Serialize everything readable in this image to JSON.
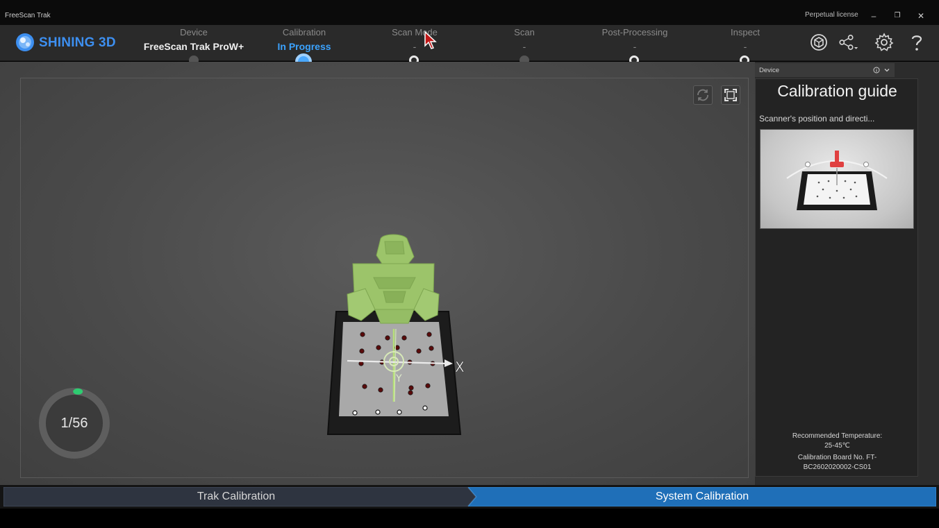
{
  "window": {
    "title": "FreeScan Trak",
    "license": "Perpetual license",
    "minimize": "–",
    "restore": "❐",
    "close": "✕"
  },
  "brand": {
    "name": "SHINING 3D"
  },
  "steps": [
    {
      "label": "Device",
      "value": "FreeScan Trak ProW+"
    },
    {
      "label": "Calibration",
      "value": "In Progress"
    },
    {
      "label": "Scan Mode",
      "value": "-"
    },
    {
      "label": "Scan",
      "value": "-"
    },
    {
      "label": "Post-Processing",
      "value": "-"
    },
    {
      "label": "Inspect",
      "value": "-"
    }
  ],
  "toolbar": {
    "icons": [
      "model-icon",
      "share-icon",
      "settings-gear-icon",
      "help-icon"
    ]
  },
  "viewport": {
    "progress_text": "1/56",
    "progress_fraction": 0.018,
    "axis_x": "X",
    "axis_y": "Y"
  },
  "panel": {
    "header": "Device",
    "guide_title": "Calibration guide",
    "guide_subtitle": "Scanner's position and directi...",
    "temp_label": "Recommended Temperature:",
    "temp_value": "25-45℃",
    "board_label": "Calibration Board No. FT-",
    "board_value": "BC2602020002-CS01"
  },
  "bottom": {
    "tab_trak": "Trak Calibration",
    "tab_system": "System Calibration"
  },
  "colors": {
    "accent": "#3ba3ff",
    "brand": "#3d8ff0",
    "active_tab": "#1f6fb8",
    "model_green": "#9cc46a",
    "progress_green": "#2ecc71"
  }
}
